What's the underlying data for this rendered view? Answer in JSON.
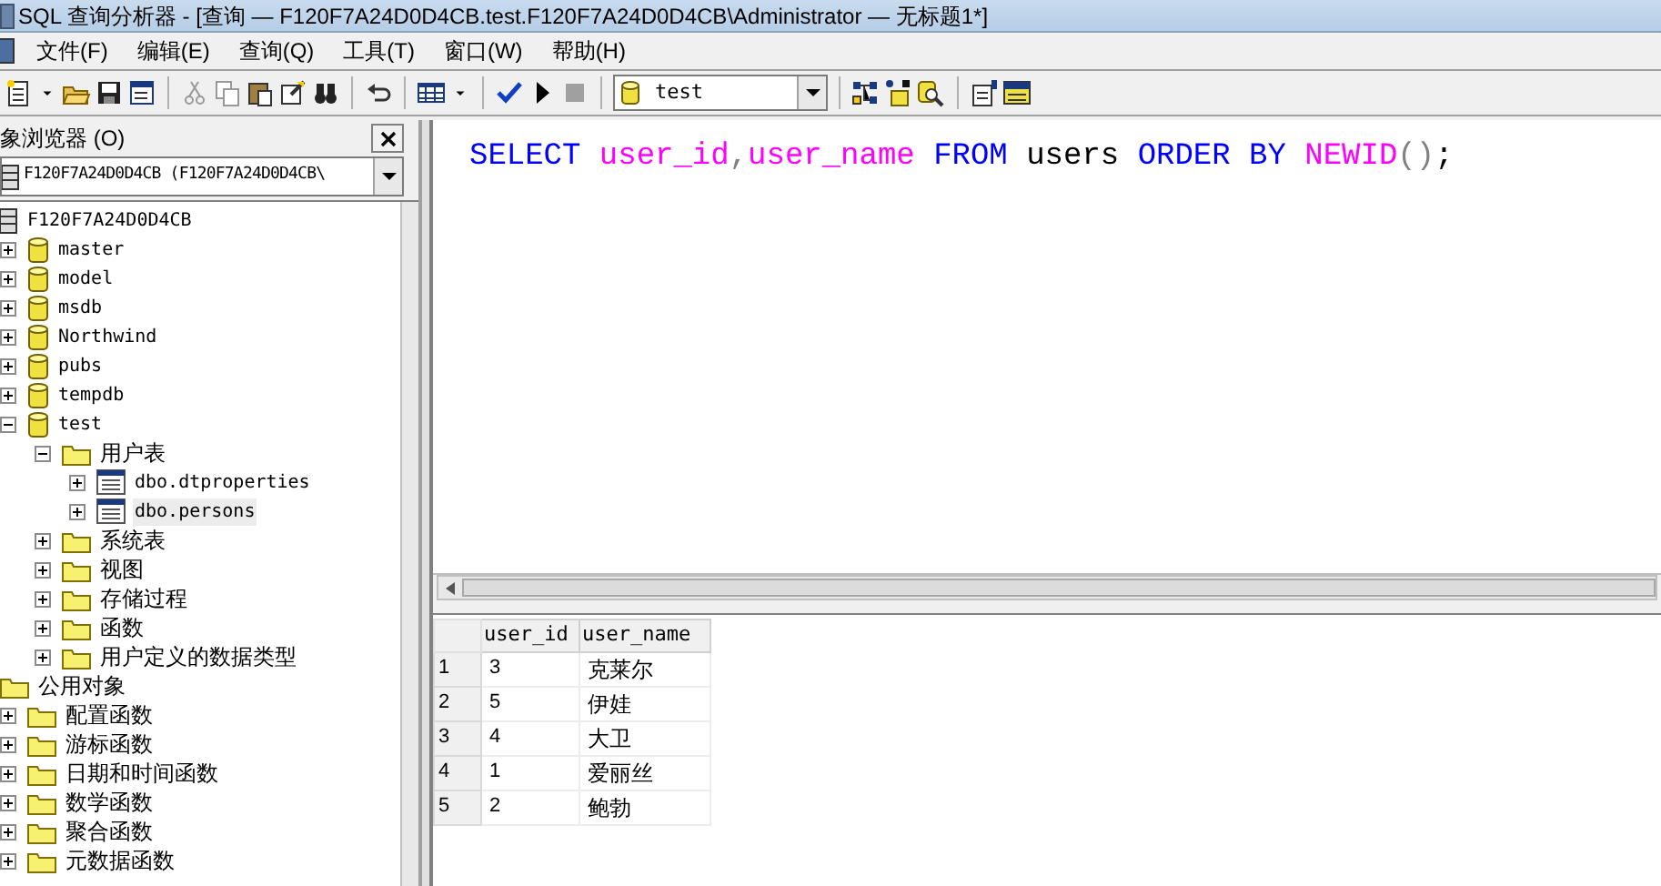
{
  "window": {
    "title": "SQL 查询分析器 - [查询 — F120F7A24D0D4CB.test.F120F7A24D0D4CB\\Administrator — 无标题1*]"
  },
  "menu": [
    "文件(F)",
    "编辑(E)",
    "查询(Q)",
    "工具(T)",
    "窗口(W)",
    "帮助(H)"
  ],
  "toolbar": {
    "database": "test"
  },
  "object_browser": {
    "title": "象浏览器 (O)",
    "server_select": "F120F7A24D0D4CB (F120F7A24D0D4CB\\",
    "tree": [
      {
        "label": "F120F7A24D0D4CB",
        "kind": "server",
        "selected": false,
        "children": [
          {
            "label": "master",
            "kind": "database",
            "expanded": false,
            "selected": false
          },
          {
            "label": "model",
            "kind": "database",
            "expanded": false,
            "selected": false
          },
          {
            "label": "msdb",
            "kind": "database",
            "expanded": false,
            "selected": false
          },
          {
            "label": "Northwind",
            "kind": "database",
            "expanded": false,
            "selected": false
          },
          {
            "label": "pubs",
            "kind": "database",
            "expanded": false,
            "selected": false
          },
          {
            "label": "tempdb",
            "kind": "database",
            "expanded": false,
            "selected": false
          },
          {
            "label": "test",
            "kind": "database",
            "expanded": true,
            "selected": false,
            "children": [
              {
                "label": "用户表",
                "kind": "folder",
                "expanded": true,
                "selected": false,
                "children": [
                  {
                    "label": "dbo.dtproperties",
                    "kind": "table",
                    "expanded": false,
                    "selected": false
                  },
                  {
                    "label": "dbo.persons",
                    "kind": "table",
                    "expanded": false,
                    "selected": true
                  }
                ]
              },
              {
                "label": "系统表",
                "kind": "folder",
                "expanded": false,
                "selected": false
              },
              {
                "label": "视图",
                "kind": "folder",
                "expanded": false,
                "selected": false
              },
              {
                "label": "存储过程",
                "kind": "folder",
                "expanded": false,
                "selected": false
              },
              {
                "label": "函数",
                "kind": "folder",
                "expanded": false,
                "selected": false
              },
              {
                "label": "用户定义的数据类型",
                "kind": "folder",
                "expanded": false,
                "selected": false
              }
            ]
          }
        ]
      },
      {
        "label": "公用对象",
        "kind": "folder",
        "selected": false,
        "children": [
          {
            "label": "配置函数",
            "kind": "folder",
            "expanded": false,
            "selected": false
          },
          {
            "label": "游标函数",
            "kind": "folder",
            "expanded": false,
            "selected": false
          },
          {
            "label": "日期和时间函数",
            "kind": "folder",
            "expanded": false,
            "selected": false
          },
          {
            "label": "数学函数",
            "kind": "folder",
            "expanded": false,
            "selected": false
          },
          {
            "label": "聚合函数",
            "kind": "folder",
            "expanded": false,
            "selected": false
          },
          {
            "label": "元数据函数",
            "kind": "folder",
            "expanded": false,
            "selected": false
          }
        ]
      }
    ]
  },
  "editor": {
    "tokens": [
      {
        "text": "SELECT ",
        "color": "#0000ff"
      },
      {
        "text": "user_id",
        "color": "#ff00ff"
      },
      {
        "text": ",",
        "color": "#808080"
      },
      {
        "text": "user_name ",
        "color": "#ff00ff"
      },
      {
        "text": "FROM ",
        "color": "#0000ff"
      },
      {
        "text": "users ",
        "color": "#000000"
      },
      {
        "text": "ORDER BY ",
        "color": "#0000ff"
      },
      {
        "text": "NEWID",
        "color": "#ff00ff"
      },
      {
        "text": "()",
        "color": "#808080"
      },
      {
        "text": ";",
        "color": "#000000"
      }
    ]
  },
  "results": {
    "columns": [
      "user_id",
      "user_name"
    ],
    "rows": [
      {
        "number": "1",
        "cells": [
          "3",
          "克莱尔"
        ]
      },
      {
        "number": "2",
        "cells": [
          "5",
          "伊娃"
        ]
      },
      {
        "number": "3",
        "cells": [
          "4",
          "大卫"
        ]
      },
      {
        "number": "4",
        "cells": [
          "1",
          "爱丽丝"
        ]
      },
      {
        "number": "5",
        "cells": [
          "2",
          "鲍勃"
        ]
      }
    ]
  }
}
